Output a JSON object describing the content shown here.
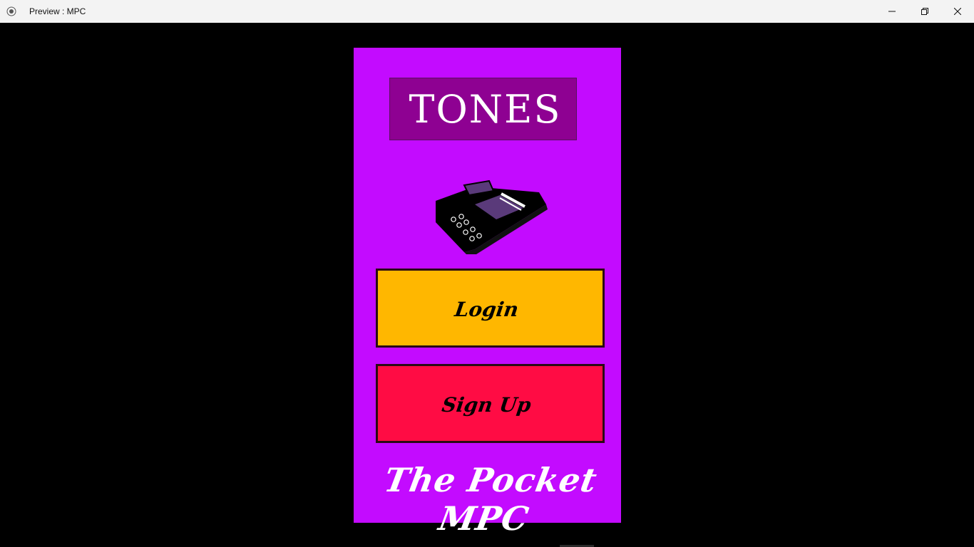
{
  "window": {
    "title": "Preview : MPC",
    "icons": {
      "app": "radio-dot-icon",
      "minimize": "minimize-icon",
      "restore": "restore-icon",
      "close": "close-icon"
    }
  },
  "app": {
    "logo_text": "TONES",
    "device_icon": "mpc-device-icon",
    "login_label": "Login",
    "signup_label": "Sign Up",
    "tagline": "The Pocket MPC"
  },
  "colors": {
    "background": "#000000",
    "panel": "#c30bff",
    "logo_box": "#8e0192",
    "login_button": "#ffb700",
    "signup_button": "#ff0c44"
  }
}
